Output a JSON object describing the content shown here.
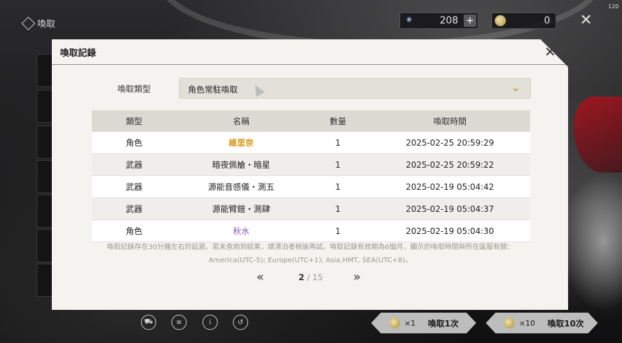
{
  "screen": {
    "title": "喚取",
    "fps": "120",
    "stars": "208",
    "coins": "0"
  },
  "modal": {
    "title": "喚取記錄",
    "type_label": "喚取類型",
    "type_value": "角色常駐喚取",
    "columns": [
      "類型",
      "名稱",
      "數量",
      "喚取時間"
    ],
    "rows": [
      {
        "type": "角色",
        "name": "維里奈",
        "qty": "1",
        "time": "2025-02-25 20:59:29",
        "rarity": "gold"
      },
      {
        "type": "武器",
        "name": "暗夜佩槍・暗星",
        "qty": "1",
        "time": "2025-02-25 20:59:22",
        "rarity": "normal"
      },
      {
        "type": "武器",
        "name": "源能音感儀・測五",
        "qty": "1",
        "time": "2025-02-19 05:04:42",
        "rarity": "normal"
      },
      {
        "type": "武器",
        "name": "源能臂鎧・測肆",
        "qty": "1",
        "time": "2025-02-19 05:04:37",
        "rarity": "normal"
      },
      {
        "type": "角色",
        "name": "秋水",
        "qty": "1",
        "time": "2025-02-19 05:04:30",
        "rarity": "purple"
      }
    ],
    "note_line1": "喚取記錄存在30分鐘左右的延遲。若未查詢到結果，請漂泊者稍後再試。喚取記錄有效期為6個月，顯示的喚取時間與所在區服有關：",
    "note_line2": "America(UTC-5); Europe(UTC+1); Asia,HMT, SEA(UTC+8)。",
    "page_current": "2",
    "page_total": "/ 15"
  },
  "bottom": {
    "pull1_count": "×1",
    "pull1_label": "喚取1次",
    "pull10_count": "×10",
    "pull10_label": "喚取10次"
  },
  "colors": {
    "gold": "#d49a1b",
    "purple": "#8a5ab8",
    "accent": "#c39a3a"
  }
}
